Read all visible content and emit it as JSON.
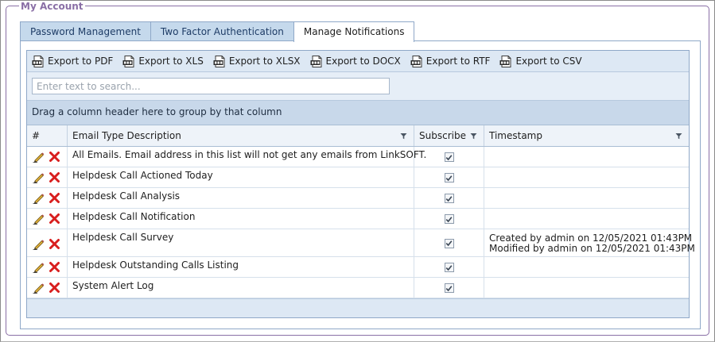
{
  "account": {
    "legend": "My Account"
  },
  "tabs": [
    {
      "label": "Password Management",
      "active": false
    },
    {
      "label": "Two Factor Authentication",
      "active": false
    },
    {
      "label": "Manage Notifications",
      "active": true
    }
  ],
  "toolbar": {
    "exports": [
      {
        "label": "Export to PDF",
        "icon": "pdf-file-icon",
        "tag": "PDF"
      },
      {
        "label": "Export to XLS",
        "icon": "xls-file-icon",
        "tag": "XLS"
      },
      {
        "label": "Export to XLSX",
        "icon": "xlsx-file-icon",
        "tag": "XLSX"
      },
      {
        "label": "Export to DOCX",
        "icon": "docx-file-icon",
        "tag": "DOCX"
      },
      {
        "label": "Export to RTF",
        "icon": "rtf-file-icon",
        "tag": "RTF"
      },
      {
        "label": "Export to CSV",
        "icon": "csv-file-icon",
        "tag": "CSV"
      }
    ]
  },
  "search": {
    "placeholder": "Enter text to search...",
    "value": ""
  },
  "group_panel": {
    "text": "Drag a column header here to group by that column"
  },
  "grid": {
    "columns": [
      "#",
      "Email Type Description",
      "Subscribe",
      "Timestamp"
    ],
    "rows": [
      {
        "description": "All Emails. Email address in this list will not get any emails from LinkSOFT.",
        "subscribed": true,
        "timestamp": []
      },
      {
        "description": "Helpdesk Call Actioned Today",
        "subscribed": true,
        "timestamp": []
      },
      {
        "description": "Helpdesk Call Analysis",
        "subscribed": true,
        "timestamp": []
      },
      {
        "description": "Helpdesk Call Notification",
        "subscribed": true,
        "timestamp": []
      },
      {
        "description": "Helpdesk Call Survey",
        "subscribed": true,
        "timestamp": [
          "Created by admin on 12/05/2021 01:43PM",
          "Modified by admin on 12/05/2021 01:43PM"
        ]
      },
      {
        "description": "Helpdesk Outstanding Calls Listing",
        "subscribed": true,
        "timestamp": []
      },
      {
        "description": "System Alert Log",
        "subscribed": true,
        "timestamp": []
      }
    ]
  },
  "colors": {
    "legend": "#8a6fa6",
    "tab_inactive_bg": "#c5d9ec",
    "toolbar_bg": "#dde8f4",
    "group_panel_bg": "#c8d8ea",
    "delete_red": "#d81e1e"
  }
}
